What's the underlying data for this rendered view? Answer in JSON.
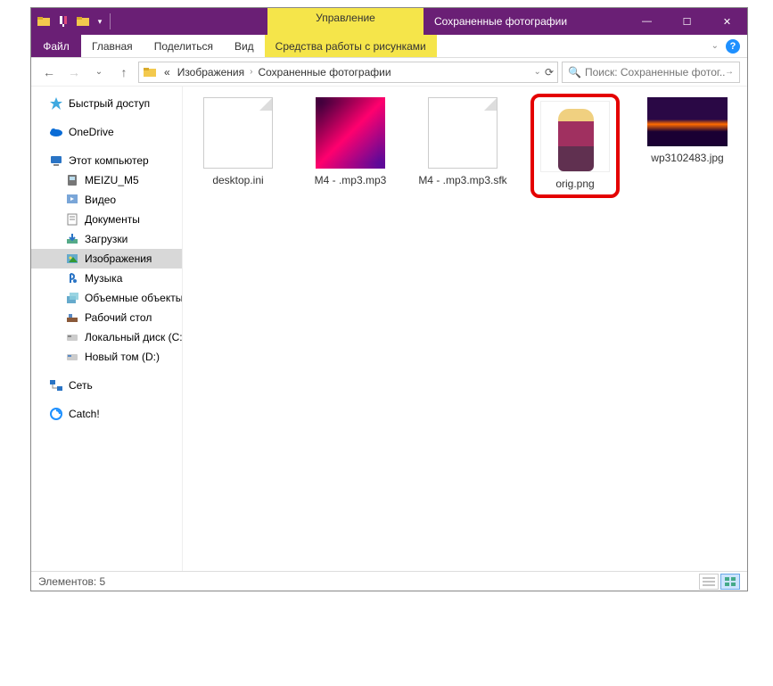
{
  "titlebar": {
    "context_tab": "Управление",
    "title": "Сохраненные фотографии"
  },
  "ribbon": {
    "file": "Файл",
    "tabs": [
      "Главная",
      "Поделиться",
      "Вид"
    ],
    "context_tab": "Средства работы с рисунками"
  },
  "breadcrumb": {
    "prefix": "«",
    "parts": [
      "Изображения",
      "Сохраненные фотографии"
    ]
  },
  "search": {
    "placeholder": "Поиск: Сохраненные фотог..."
  },
  "sidebar": {
    "quick_access": "Быстрый доступ",
    "onedrive": "OneDrive",
    "this_pc": "Этот компьютер",
    "pc_items": [
      "MEIZU_M5",
      "Видео",
      "Документы",
      "Загрузки",
      "Изображения",
      "Музыка",
      "Объемные объекты",
      "Рабочий стол",
      "Локальный диск (C:)",
      "Новый том (D:)"
    ],
    "selected_index": 4,
    "network": "Сеть",
    "catch": "Catch!"
  },
  "files": [
    {
      "name": "desktop.ini",
      "thumb": "blank"
    },
    {
      "name": "M4 - .mp3.mp3",
      "thumb": "neon"
    },
    {
      "name": "M4 - .mp3.mp3.sfk",
      "thumb": "blank"
    },
    {
      "name": "orig.png",
      "thumb": "person",
      "highlighted": true
    },
    {
      "name": "wp3102483.jpg",
      "thumb": "sunset"
    }
  ],
  "statusbar": {
    "count_label": "Элементов: 5"
  }
}
